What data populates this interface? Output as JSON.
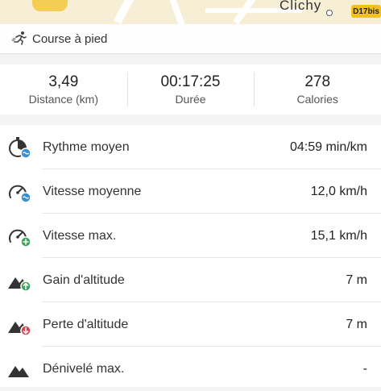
{
  "map": {
    "city_label": "Clichy",
    "road_badge": "D17bis"
  },
  "activity": {
    "icon": "runner-icon",
    "label": "Course à pied"
  },
  "stats": [
    {
      "value": "3,49",
      "caption": "Distance (km)"
    },
    {
      "value": "00:17:25",
      "caption": "Durée"
    },
    {
      "value": "278",
      "caption": "Calories"
    }
  ],
  "metrics": [
    {
      "label": "Rythme moyen",
      "value": "04:59 min/km",
      "icon": "pace-icon",
      "badge_color": "#3a8fd1"
    },
    {
      "label": "Vitesse moyenne",
      "value": "12,0 km/h",
      "icon": "speedometer-avg-icon",
      "badge_color": "#3a8fd1"
    },
    {
      "label": "Vitesse max.",
      "value": "15,1 km/h",
      "icon": "speedometer-max-icon",
      "badge_color": "#3aa55a"
    },
    {
      "label": "Gain d'altitude",
      "value": "7 m",
      "icon": "altitude-gain-icon",
      "badge_color": "#3aa55a"
    },
    {
      "label": "Perte d'altitude",
      "value": "7 m",
      "icon": "altitude-loss-icon",
      "badge_color": "#d94350"
    },
    {
      "label": "Dénivelé max.",
      "value": "-",
      "icon": "elevation-icon",
      "badge_color": ""
    }
  ]
}
